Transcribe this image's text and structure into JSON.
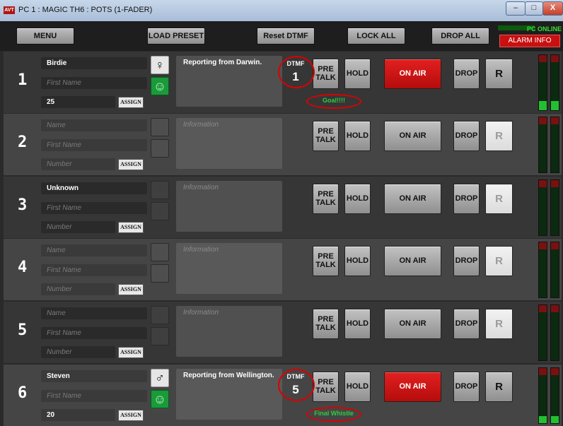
{
  "window": {
    "title": "PC 1 : MAGIC TH6 : POTS (1-FADER)",
    "logo": "AVT",
    "minimize": "–",
    "maximize": "□",
    "close": "X"
  },
  "toolbar": {
    "menu": "MENU",
    "load_preset": "LOAD PRESET",
    "reset_dtmf": "Reset DTMF",
    "lock_all": "LOCK ALL",
    "drop_all": "DROP ALL",
    "pc_online": "PC ONLINE",
    "alarm_info": "ALARM INFO"
  },
  "placeholders": {
    "name": "Name",
    "first_name": "First Name",
    "number": "Number",
    "information": "Information"
  },
  "labels": {
    "assign": "ASSIGN",
    "dtmf": "DTMF",
    "pre_talk": "PRE TALK",
    "hold": "HOLD",
    "on_air": "ON AIR",
    "drop": "DROP",
    "r": "R"
  },
  "lines": [
    {
      "num": "1",
      "name": "Birdie",
      "first_name": "",
      "number": "25",
      "gender_icon": "female-icon",
      "gender_glyph": "♀",
      "information": "Reporting from Darwin.",
      "dtmf": "1",
      "status": "Goal!!!!",
      "on_air": true,
      "meter_level": 0.2
    },
    {
      "num": "2",
      "name": "",
      "first_name": "",
      "number": "",
      "information": "",
      "on_air": false,
      "meter_level": 0
    },
    {
      "num": "3",
      "name": "Unknown",
      "first_name": "",
      "number": "",
      "information": "",
      "on_air": false,
      "meter_level": 0
    },
    {
      "num": "4",
      "name": "",
      "first_name": "",
      "number": "",
      "information": "",
      "on_air": false,
      "meter_level": 0
    },
    {
      "num": "5",
      "name": "",
      "first_name": "",
      "number": "",
      "information": "",
      "on_air": false,
      "meter_level": 0
    },
    {
      "num": "6",
      "name": "Steven",
      "first_name": "",
      "number": "20",
      "gender_icon": "male-icon",
      "gender_glyph": "♂",
      "information": "Reporting from Wellington.",
      "dtmf": "5",
      "status": "Final Whistle",
      "on_air": true,
      "meter_level": 0.15
    }
  ],
  "colors": {
    "on_air_live": "#c81010",
    "status_text": "#2ecc40",
    "alarm": "#c81010"
  }
}
